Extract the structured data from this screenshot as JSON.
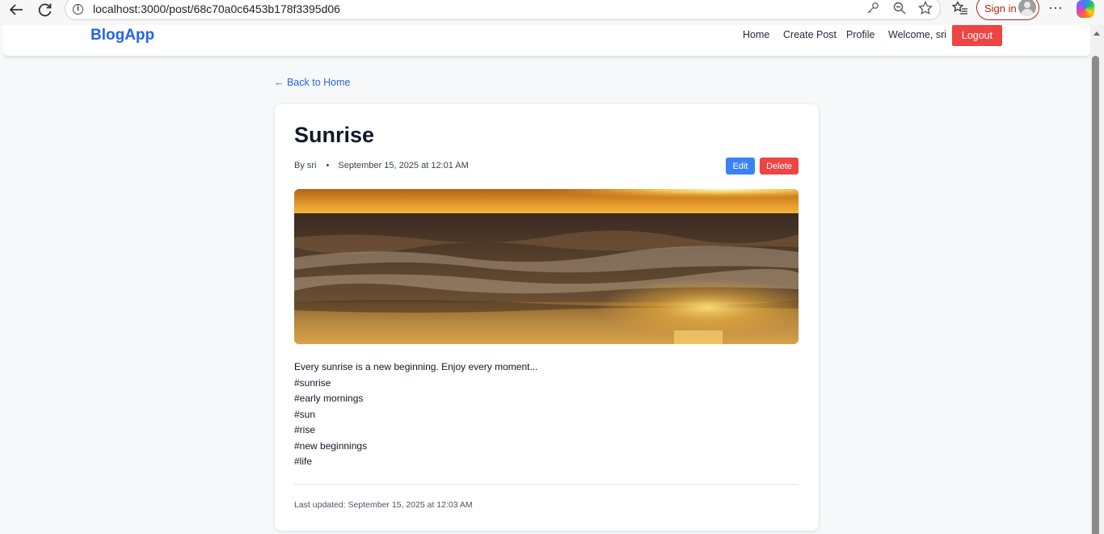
{
  "browser": {
    "url": "localhost:3000/post/68c70a0c6453b178f3395d06",
    "signin_label": "Sign in",
    "more_label": "···"
  },
  "nav": {
    "brand": "BlogApp",
    "links": [
      "Home",
      "Create Post",
      "Profile"
    ],
    "welcome": "Welcome, sri",
    "logout": "Logout"
  },
  "back_link": "← Back to Home",
  "post": {
    "title": "Sunrise",
    "author": "By sri",
    "separator": "•",
    "date": "September 15, 2025 at 12:01 AM",
    "edit_label": "Edit",
    "delete_label": "Delete",
    "body_lines": [
      "Every sunrise is a new beginning. Enjoy every moment...",
      "#sunrise",
      "#early mornings",
      "#sun",
      "#rise",
      "#new beginnings",
      "#life"
    ],
    "last_updated": "Last updated: September 15, 2025 at 12:03 AM"
  },
  "colors": {
    "brand": "#2563eb",
    "edit": "#3b82f6",
    "delete": "#ef4444"
  }
}
